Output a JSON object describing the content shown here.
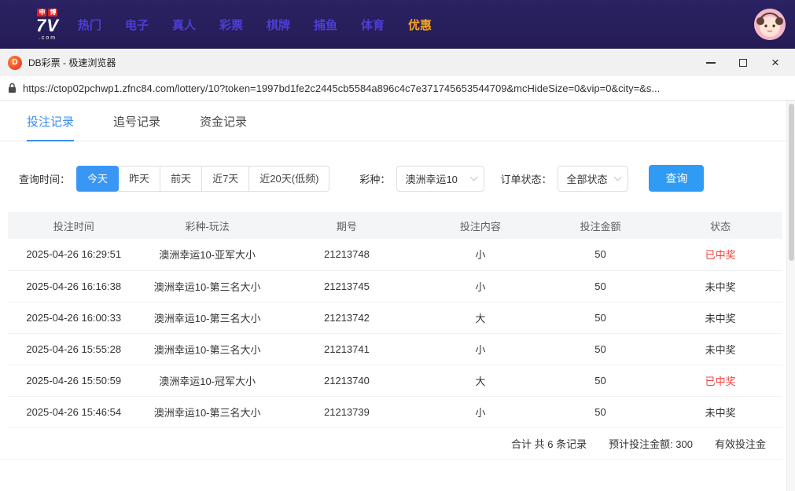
{
  "top_nav": {
    "logo": {
      "badge1": "申",
      "badge2": "博",
      "main": "7V",
      "sub": ".com"
    },
    "items": [
      {
        "label": "热门"
      },
      {
        "label": "电子"
      },
      {
        "label": "真人"
      },
      {
        "label": "彩票"
      },
      {
        "label": "棋牌"
      },
      {
        "label": "捕鱼"
      },
      {
        "label": "体育"
      },
      {
        "label": "优惠",
        "highlight": true
      }
    ]
  },
  "browser": {
    "icon_letter": "D",
    "title": "DB彩票 - 极速浏览器",
    "url": "https://ctop02pchwp1.zfnc84.com/lottery/10?token=1997bd1fe2c2445cb5584a896c4c7e371745653544709&mcHideSize=0&vip=0&city=&s..."
  },
  "tabs": [
    {
      "label": "投注记录",
      "active": true
    },
    {
      "label": "追号记录",
      "active": false
    },
    {
      "label": "资金记录",
      "active": false
    }
  ],
  "filters": {
    "time_label": "查询时间：",
    "time_options": [
      {
        "label": "今天",
        "active": true
      },
      {
        "label": "昨天",
        "active": false
      },
      {
        "label": "前天",
        "active": false
      },
      {
        "label": "近7天",
        "active": false
      },
      {
        "label": "近20天(低频)",
        "active": false
      }
    ],
    "lottery_label": "彩种：",
    "lottery_value": "澳洲幸运10",
    "status_label": "订单状态：",
    "status_value": "全部状态",
    "query_button": "查询"
  },
  "table": {
    "headers": [
      "投注时间",
      "彩种-玩法",
      "期号",
      "投注内容",
      "投注金额",
      "状态"
    ],
    "rows": [
      {
        "time": "2025-04-26 16:29:51",
        "game": "澳洲幸运10-亚军大小",
        "issue": "21213748",
        "content": "小",
        "amount": "50",
        "status": "已中奖",
        "won": true
      },
      {
        "time": "2025-04-26 16:16:38",
        "game": "澳洲幸运10-第三名大小",
        "issue": "21213745",
        "content": "小",
        "amount": "50",
        "status": "未中奖",
        "won": false
      },
      {
        "time": "2025-04-26 16:00:33",
        "game": "澳洲幸运10-第三名大小",
        "issue": "21213742",
        "content": "大",
        "amount": "50",
        "status": "未中奖",
        "won": false
      },
      {
        "time": "2025-04-26 15:55:28",
        "game": "澳洲幸运10-第三名大小",
        "issue": "21213741",
        "content": "小",
        "amount": "50",
        "status": "未中奖",
        "won": false
      },
      {
        "time": "2025-04-26 15:50:59",
        "game": "澳洲幸运10-冠军大小",
        "issue": "21213740",
        "content": "大",
        "amount": "50",
        "status": "已中奖",
        "won": true
      },
      {
        "time": "2025-04-26 15:46:54",
        "game": "澳洲幸运10-第三名大小",
        "issue": "21213739",
        "content": "小",
        "amount": "50",
        "status": "未中奖",
        "won": false
      }
    ],
    "summary": {
      "total": "合计 共 6 条记录",
      "expected": "预计投注金额: 300",
      "valid": "有效投注金"
    }
  },
  "colors": {
    "topbar_bg": "#281f5c",
    "nav_item": "#4c3ed6",
    "nav_highlight": "#f6a21c",
    "accent_blue": "#3a96f5",
    "win_red": "#f0413c"
  }
}
